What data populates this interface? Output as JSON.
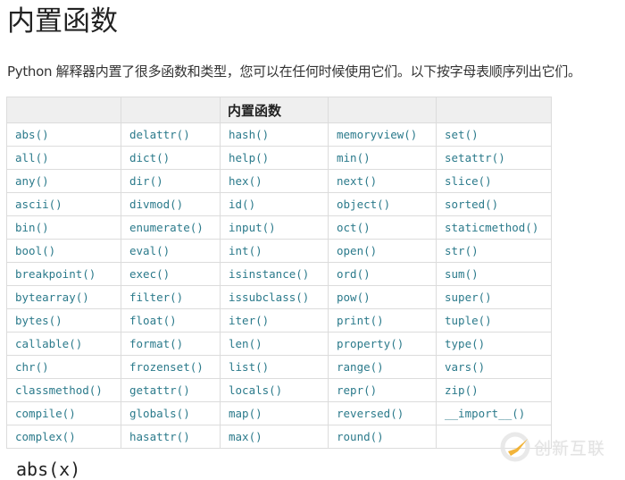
{
  "page": {
    "title": "内置函数",
    "intro": "Python 解释器内置了很多函数和类型，您可以在任何时候使用它们。以下按字母表顺序列出它们。"
  },
  "table": {
    "header": [
      "",
      "",
      "内置函数",
      "",
      ""
    ],
    "rows": [
      [
        "abs()",
        "delattr()",
        "hash()",
        "memoryview()",
        "set()"
      ],
      [
        "all()",
        "dict()",
        "help()",
        "min()",
        "setattr()"
      ],
      [
        "any()",
        "dir()",
        "hex()",
        "next()",
        "slice()"
      ],
      [
        "ascii()",
        "divmod()",
        "id()",
        "object()",
        "sorted()"
      ],
      [
        "bin()",
        "enumerate()",
        "input()",
        "oct()",
        "staticmethod()"
      ],
      [
        "bool()",
        "eval()",
        "int()",
        "open()",
        "str()"
      ],
      [
        "breakpoint()",
        "exec()",
        "isinstance()",
        "ord()",
        "sum()"
      ],
      [
        "bytearray()",
        "filter()",
        "issubclass()",
        "pow()",
        "super()"
      ],
      [
        "bytes()",
        "float()",
        "iter()",
        "print()",
        "tuple()"
      ],
      [
        "callable()",
        "format()",
        "len()",
        "property()",
        "type()"
      ],
      [
        "chr()",
        "frozenset()",
        "list()",
        "range()",
        "vars()"
      ],
      [
        "classmethod()",
        "getattr()",
        "locals()",
        "repr()",
        "zip()"
      ],
      [
        "compile()",
        "globals()",
        "map()",
        "reversed()",
        "__import__()"
      ],
      [
        "complex()",
        "hasattr()",
        "max()",
        "round()",
        ""
      ]
    ]
  },
  "next_heading": "abs(x)",
  "watermark": {
    "text": "创新互联",
    "icon": "brand-logo-icon",
    "accent": "#f0a818"
  },
  "colors": {
    "link": "#2b7a8b",
    "header_bg": "#efefef",
    "border": "#dcdcdc"
  }
}
